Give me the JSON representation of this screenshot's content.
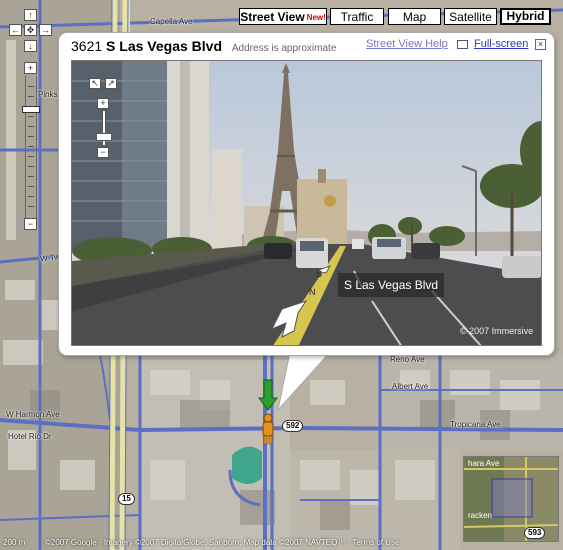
{
  "map_types": {
    "street_view": "Street View",
    "street_view_badge": "New!",
    "traffic": "Traffic",
    "map": "Map",
    "satellite": "Satellite",
    "hybrid": "Hybrid",
    "active": "hybrid"
  },
  "nav_controls": {
    "pan_up": "↑",
    "pan_left": "←",
    "pan_center": "✥",
    "pan_right": "→",
    "pan_down": "↓",
    "zoom_in": "+",
    "zoom_out": "−"
  },
  "info_window": {
    "address_number": "3621",
    "address_street": "S Las Vegas Blvd",
    "note": "Address is approximate",
    "help_link": "Street View Help",
    "fullscreen_link": "Full-screen",
    "close": "×"
  },
  "panorama": {
    "expand_left": "↖",
    "expand_right": "↗",
    "zoom_in": "+",
    "zoom_out": "−",
    "street_label": "S Las Vegas Blvd",
    "copyright": "© 2007 Immersive",
    "road_letters": [
      "S",
      "N"
    ]
  },
  "map_labels": {
    "capella": "Capella Ave",
    "pinks": "Pinks",
    "twain": "W Twain Ave",
    "harmon_w": "W Harmon Ave",
    "hotel_rio": "Hotel Rio Dr",
    "albert": "Albert Ave",
    "reno": "Reno Ave",
    "tropicana_e": "Tropicana Ave",
    "shield_592": "592",
    "shield_15": "15",
    "mini_shield": "593",
    "mini_sahara": "hara Ave",
    "mini_tracken": "racken"
  },
  "footer": {
    "scale": "200 m",
    "attribution": "©2007 Google · Imagery ©2007 DigitalGlobe, Sanborn, Map data ©2007 NAVTEQ™ · Terms of Use"
  },
  "colors": {
    "road_blue": "#5b6fc4",
    "accent_link": "#3333cc",
    "pegman": "#e8901c",
    "pointer_green": "#2e9e2e"
  }
}
